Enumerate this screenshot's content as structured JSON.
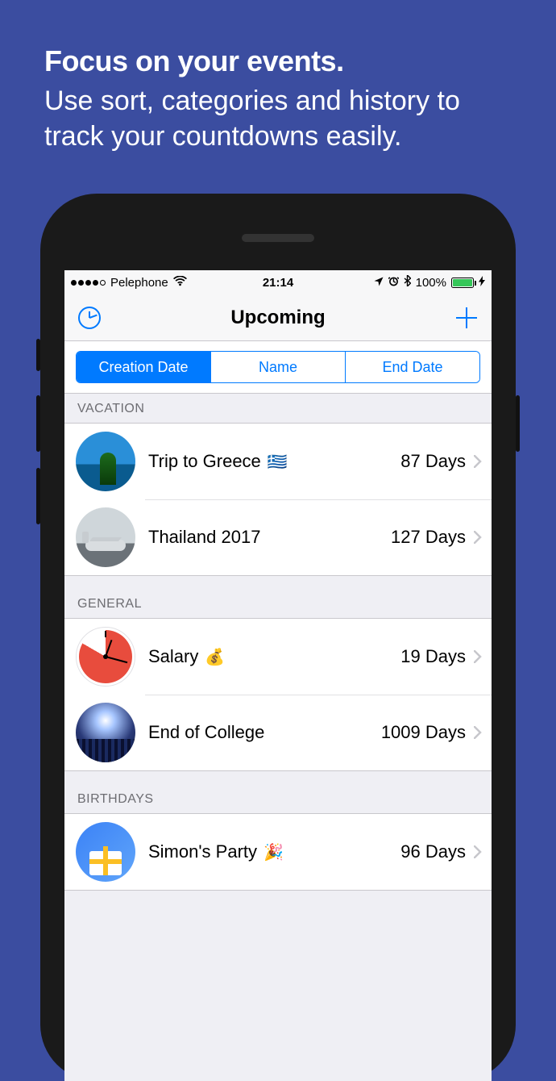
{
  "promo": {
    "headline": "Focus on your events.",
    "sub": "Use sort, categories and history to track your countdowns easily."
  },
  "status": {
    "carrier": "Pelephone",
    "time": "21:14",
    "battery_pct": "100%"
  },
  "nav": {
    "title": "Upcoming"
  },
  "segments": {
    "s0": "Creation Date",
    "s1": "Name",
    "s2": "End Date",
    "active_index": 0
  },
  "sections": [
    {
      "header": "VACATION",
      "rows": [
        {
          "title": "Trip to Greece",
          "emoji": "🇬🇷",
          "count": "87 Days",
          "thumb": "greece"
        },
        {
          "title": "Thailand 2017",
          "emoji": "",
          "count": "127 Days",
          "thumb": "thailand"
        }
      ]
    },
    {
      "header": "GENERAL",
      "rows": [
        {
          "title": "Salary",
          "emoji": "💰",
          "count": "19 Days",
          "thumb": "clock"
        },
        {
          "title": "End of College",
          "emoji": "",
          "count": "1009 Days",
          "thumb": "college"
        }
      ]
    },
    {
      "header": "BIRTHDAYS",
      "rows": [
        {
          "title": "Simon's Party",
          "emoji": "🎉",
          "count": "96 Days",
          "thumb": "gift"
        }
      ]
    }
  ]
}
